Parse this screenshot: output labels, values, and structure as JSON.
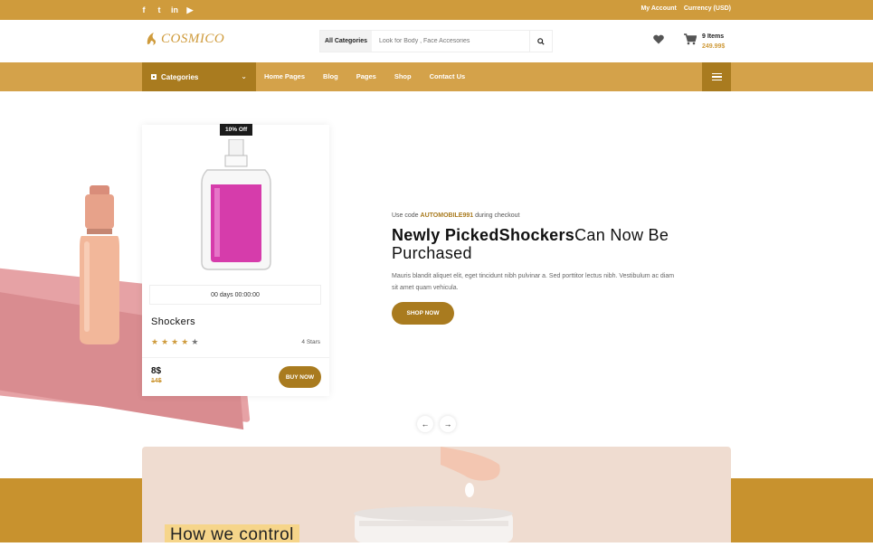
{
  "topbar": {
    "social": [
      {
        "name": "facebook-icon",
        "glyph": "f"
      },
      {
        "name": "twitter-icon",
        "glyph": "t"
      },
      {
        "name": "linkedin-icon",
        "glyph": "in"
      },
      {
        "name": "youtube-icon",
        "glyph": "▶"
      }
    ],
    "my_account": "My Account",
    "currency": "Currency (USD)"
  },
  "header": {
    "logo": "COSMICO",
    "search": {
      "category": "All Categories",
      "placeholder": "Look for Body , Face Accesories"
    },
    "cart": {
      "items": "9 Items",
      "total": "249.99$"
    }
  },
  "nav": {
    "categories_label": "Categories",
    "links": [
      "Home Pages",
      "Blog",
      "Pages",
      "Shop",
      "Contact Us"
    ]
  },
  "product_card": {
    "badge": "10% Off",
    "countdown": "00 days 00:00:00",
    "name": "Shockers",
    "rating": 4,
    "rating_text": "4 Stars",
    "price": "8$",
    "old_price": "14$",
    "buy_label": "BUY NOW"
  },
  "hero": {
    "promo_prefix": "Use code ",
    "promo_code": "AUTOMOBILE991",
    "promo_suffix": " during checkout",
    "headline_bold": "Newly PickedShockers",
    "headline_rest": "Can Now Be Purchased",
    "description": "Mauris blandit aliquet elit, eget tincidunt nibh pulvinar a. Sed porttitor lectus nibh. Vestibulum ac diam sit amet quam vehicula.",
    "cta": "SHOP NOW",
    "prev_arrow": "←",
    "next_arrow": "→"
  },
  "section": {
    "title": "How we control"
  },
  "colors": {
    "accent": "#cf9b3c",
    "accent_dark": "#a97b1f",
    "nav_bg": "#d4a24a"
  }
}
